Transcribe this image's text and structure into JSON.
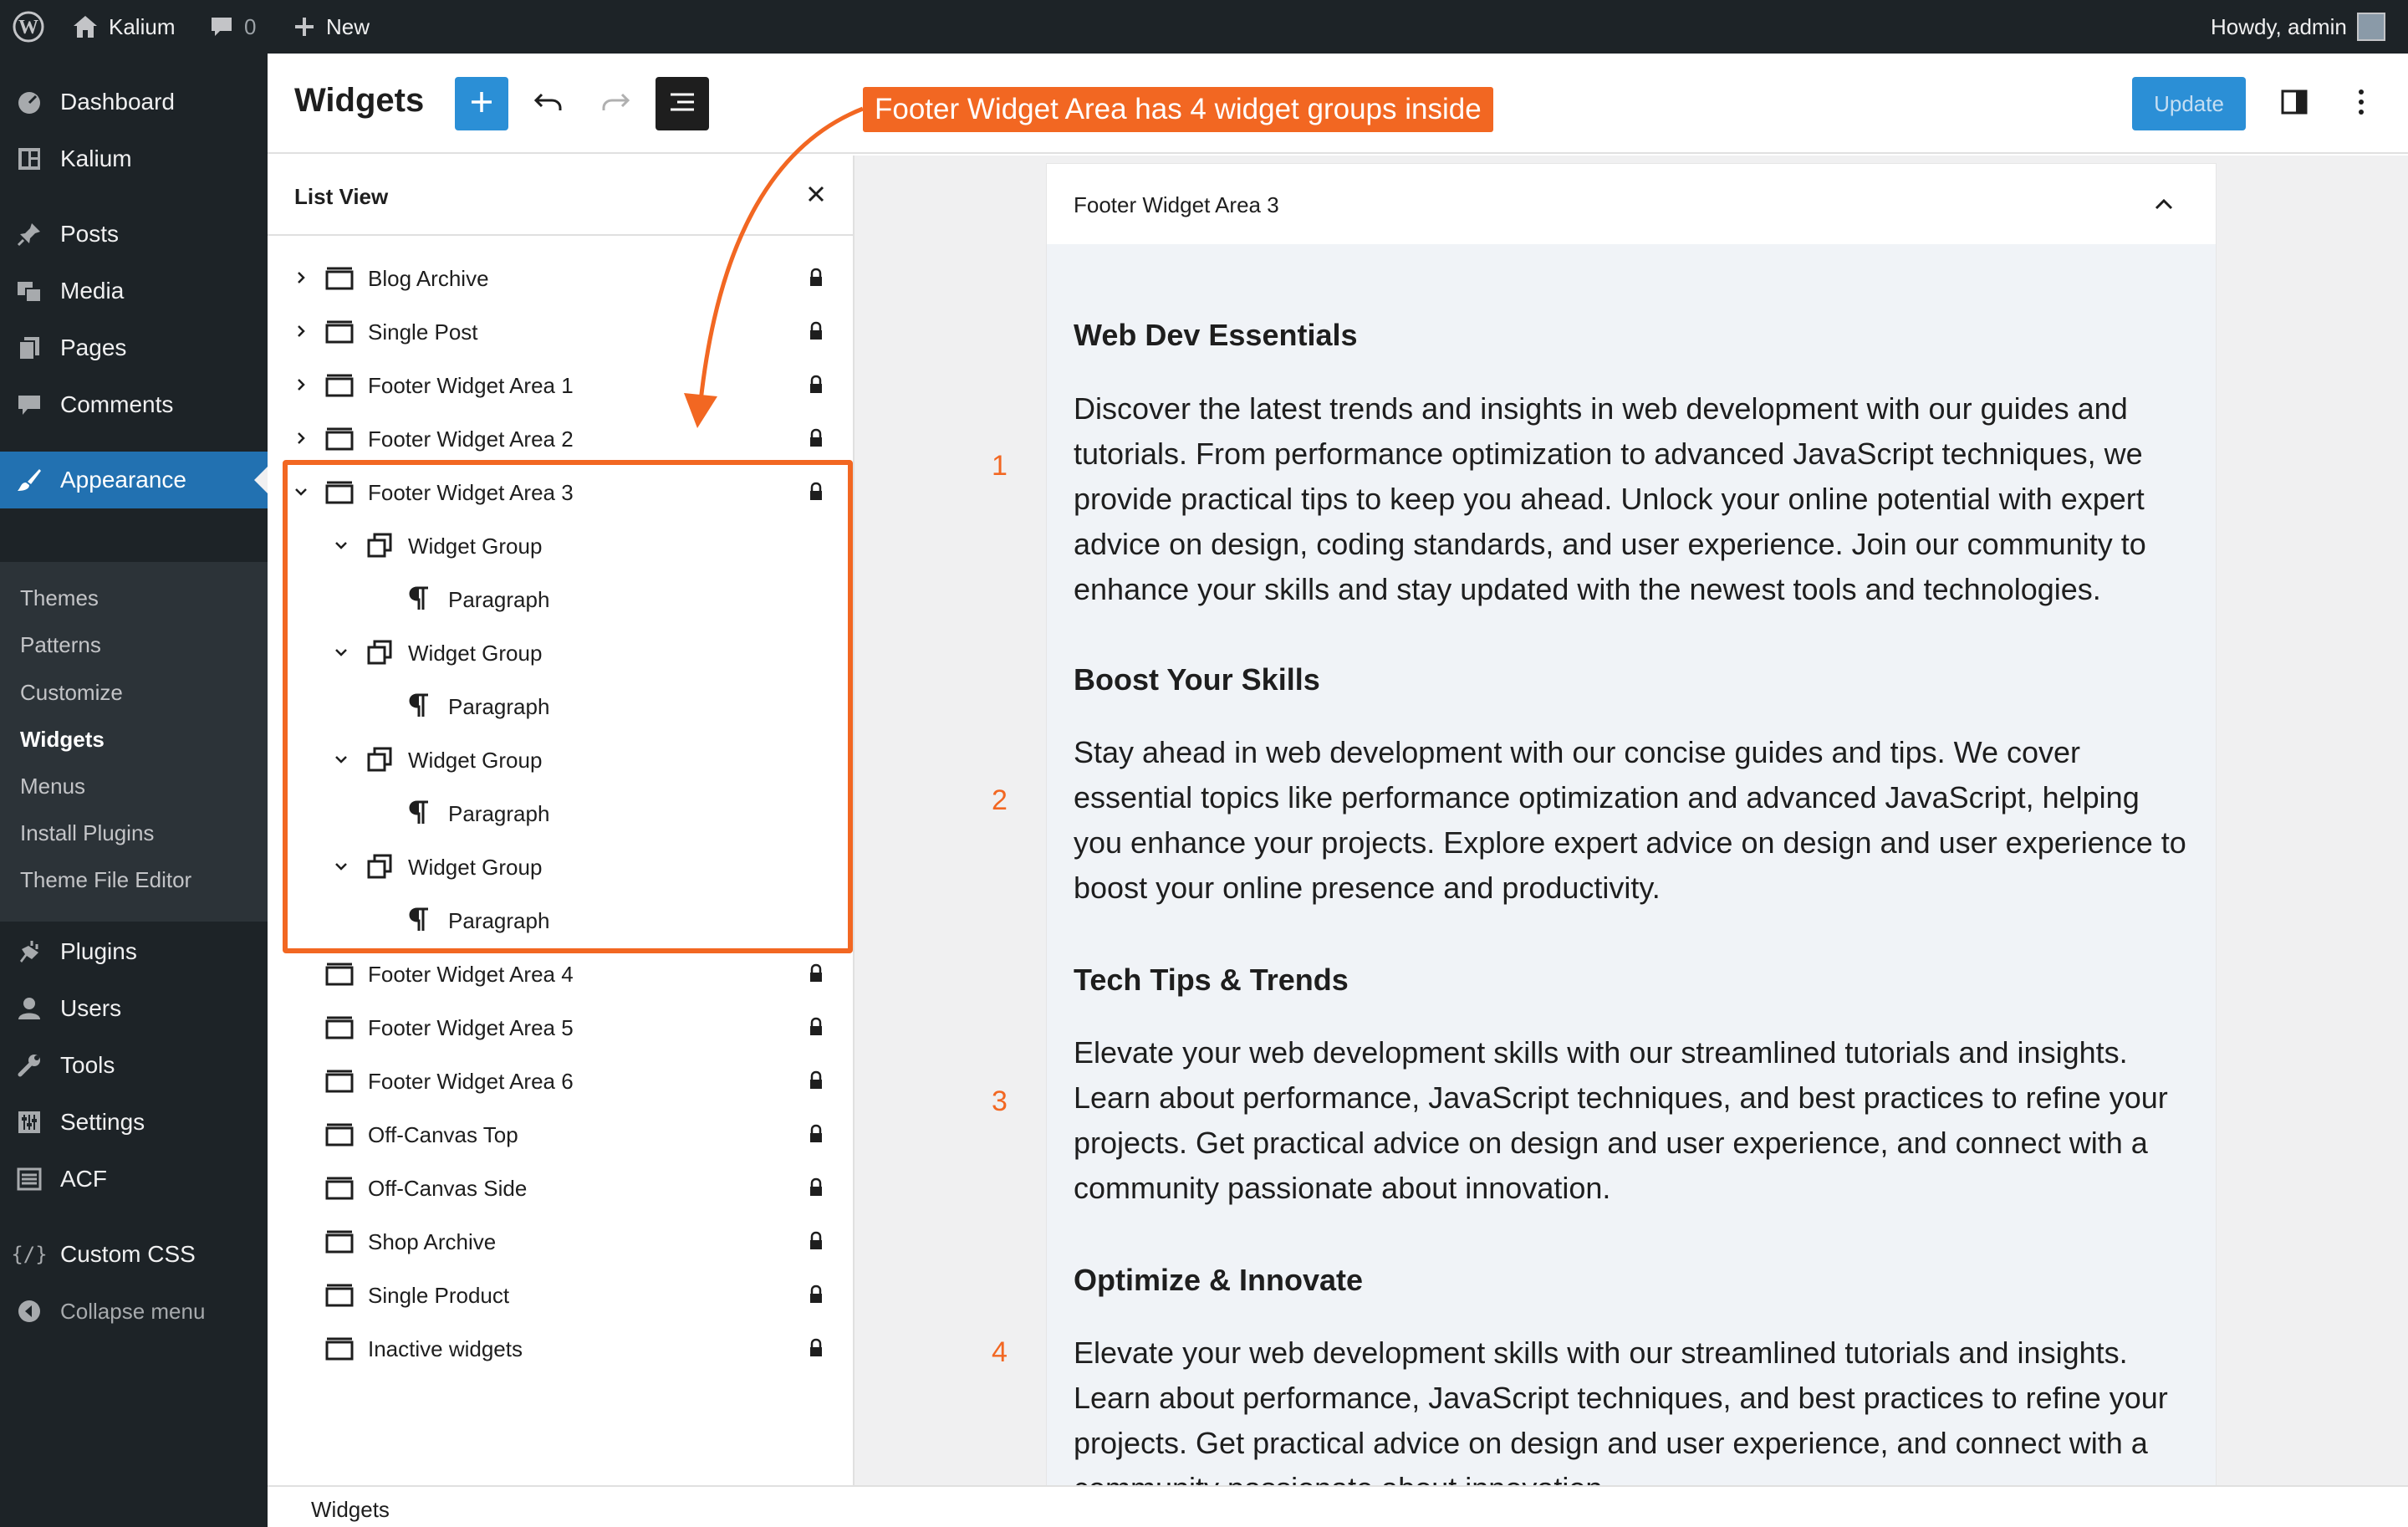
{
  "adminbar": {
    "site_name": "Kalium",
    "comments_count": "0",
    "new_label": "New",
    "howdy": "Howdy, admin"
  },
  "admin_menu": {
    "items": [
      {
        "label": "Dashboard",
        "icon": "dashboard-icon"
      },
      {
        "label": "Kalium",
        "icon": "theme-icon"
      },
      {
        "label": "Posts",
        "icon": "pin-icon"
      },
      {
        "label": "Media",
        "icon": "media-icon"
      },
      {
        "label": "Pages",
        "icon": "pages-icon"
      },
      {
        "label": "Comments",
        "icon": "comments-icon"
      },
      {
        "label": "Appearance",
        "icon": "brush-icon"
      },
      {
        "label": "Plugins",
        "icon": "plug-icon"
      },
      {
        "label": "Users",
        "icon": "user-icon"
      },
      {
        "label": "Tools",
        "icon": "wrench-icon"
      },
      {
        "label": "Settings",
        "icon": "settings-icon"
      },
      {
        "label": "ACF",
        "icon": "acf-icon"
      },
      {
        "label": "Custom CSS",
        "icon": "code-icon"
      },
      {
        "label": "Collapse menu",
        "icon": "collapse-icon"
      }
    ],
    "appearance_submenu": [
      "Themes",
      "Patterns",
      "Customize",
      "Widgets",
      "Menus",
      "Install Plugins",
      "Theme File Editor"
    ],
    "current_submenu": "Widgets"
  },
  "header": {
    "title": "Widgets",
    "update_label": "Update"
  },
  "list_view": {
    "title": "List View",
    "rows": [
      {
        "label": "Blog Archive",
        "level": 0,
        "chevron": "right",
        "icon": "widget-area-icon",
        "lock": true
      },
      {
        "label": "Single Post",
        "level": 0,
        "chevron": "right",
        "icon": "widget-area-icon",
        "lock": true
      },
      {
        "label": "Footer Widget Area 1",
        "level": 0,
        "chevron": "right",
        "icon": "widget-area-icon",
        "lock": true
      },
      {
        "label": "Footer Widget Area 2",
        "level": 0,
        "chevron": "right",
        "icon": "widget-area-icon",
        "lock": true
      },
      {
        "label": "Footer Widget Area 3",
        "level": 0,
        "chevron": "down",
        "icon": "widget-area-icon",
        "lock": true
      },
      {
        "label": "Widget Group",
        "level": 1,
        "chevron": "down",
        "icon": "group-icon",
        "lock": false
      },
      {
        "label": "Paragraph",
        "level": 2,
        "chevron": "none",
        "icon": "paragraph-icon",
        "lock": false
      },
      {
        "label": "Widget Group",
        "level": 1,
        "chevron": "down",
        "icon": "group-icon",
        "lock": false
      },
      {
        "label": "Paragraph",
        "level": 2,
        "chevron": "none",
        "icon": "paragraph-icon",
        "lock": false
      },
      {
        "label": "Widget Group",
        "level": 1,
        "chevron": "down",
        "icon": "group-icon",
        "lock": false
      },
      {
        "label": "Paragraph",
        "level": 2,
        "chevron": "none",
        "icon": "paragraph-icon",
        "lock": false
      },
      {
        "label": "Widget Group",
        "level": 1,
        "chevron": "down",
        "icon": "group-icon",
        "lock": false
      },
      {
        "label": "Paragraph",
        "level": 2,
        "chevron": "none",
        "icon": "paragraph-icon",
        "lock": false
      },
      {
        "label": "Footer Widget Area 4",
        "level": 0,
        "chevron": "none",
        "icon": "widget-area-icon",
        "lock": true
      },
      {
        "label": "Footer Widget Area 5",
        "level": 0,
        "chevron": "none",
        "icon": "widget-area-icon",
        "lock": true
      },
      {
        "label": "Footer Widget Area 6",
        "level": 0,
        "chevron": "none",
        "icon": "widget-area-icon",
        "lock": true
      },
      {
        "label": "Off-Canvas Top",
        "level": 0,
        "chevron": "none",
        "icon": "widget-area-icon",
        "lock": true
      },
      {
        "label": "Off-Canvas Side",
        "level": 0,
        "chevron": "none",
        "icon": "widget-area-icon",
        "lock": true
      },
      {
        "label": "Shop Archive",
        "level": 0,
        "chevron": "none",
        "icon": "widget-area-icon",
        "lock": true
      },
      {
        "label": "Single Product",
        "level": 0,
        "chevron": "none",
        "icon": "widget-area-icon",
        "lock": true
      },
      {
        "label": "Inactive widgets",
        "level": 0,
        "chevron": "none",
        "icon": "widget-area-icon",
        "lock": true
      }
    ]
  },
  "widget_area": {
    "title": "Footer Widget Area 3",
    "groups": [
      {
        "number": "1",
        "heading": "Web Dev Essentials",
        "lines": [
          "Discover the latest trends and insights in web development with our guides and",
          "tutorials. From performance optimization to advanced JavaScript techniques, we",
          "provide practical tips to keep you ahead. Unlock your online potential with expert",
          "advice on design, coding standards, and user experience. Join our community to",
          "enhance your skills and stay updated with the newest tools and technologies."
        ]
      },
      {
        "number": "2",
        "heading": "Boost Your Skills",
        "lines": [
          "Stay ahead in web development with our concise guides and tips. We cover",
          "essential topics like performance optimization and advanced JavaScript, helping",
          "you enhance your projects. Explore expert advice on design and user experience to",
          "boost your online presence and productivity."
        ]
      },
      {
        "number": "3",
        "heading": "Tech Tips & Trends",
        "lines": [
          "Elevate your web development skills with our streamlined tutorials and insights.",
          "Learn about performance, JavaScript techniques, and best practices to refine your",
          "projects. Get practical advice on design and user experience, and connect with a",
          "community passionate about innovation."
        ]
      },
      {
        "number": "4",
        "heading": "Optimize & Innovate",
        "lines": [
          "Elevate your web development skills with our streamlined tutorials and insights.",
          "Learn about performance, JavaScript techniques, and best practices to refine your",
          "projects. Get practical advice on design and user experience, and connect with a",
          "community passionate about innovation."
        ]
      }
    ]
  },
  "footer": {
    "label": "Widgets"
  },
  "annotation": {
    "callout": "Footer Widget Area has 4 widget groups inside",
    "color": "#f26722"
  },
  "colors": {
    "accent": "#2271b1",
    "update_button": "#2b8fd6",
    "admin_bg": "#1d2327",
    "annotation": "#f26722"
  }
}
